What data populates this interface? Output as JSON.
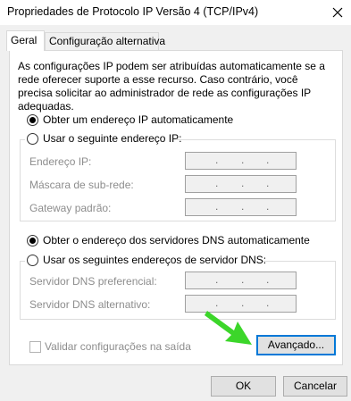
{
  "window": {
    "title": "Propriedades de Protocolo IP Versão 4 (TCP/IPv4)"
  },
  "tabs": [
    {
      "label": "Geral",
      "active": true
    },
    {
      "label": "Configuração alternativa",
      "active": false
    }
  ],
  "description": "As configurações IP podem ser atribuídas automaticamente se a rede oferecer suporte a esse recurso. Caso contrário, você precisa solicitar ao administrador de rede as configurações IP adequadas.",
  "ip": {
    "auto_label": "Obter um endereço IP automaticamente",
    "auto_selected": true,
    "manual_label": "Usar o seguinte endereço IP:",
    "fields": [
      {
        "label": "Endereço IP:",
        "value": ". . ."
      },
      {
        "label": "Máscara de sub-rede:",
        "value": ". . ."
      },
      {
        "label": "Gateway padrão:",
        "value": ". . ."
      }
    ]
  },
  "dns": {
    "auto_label": "Obter o endereço dos servidores DNS automaticamente",
    "auto_selected": true,
    "manual_label": "Usar os seguintes endereços de servidor DNS:",
    "fields": [
      {
        "label": "Servidor DNS preferencial:",
        "value": ". . ."
      },
      {
        "label": "Servidor DNS alternativo:",
        "value": ". . ."
      }
    ]
  },
  "validate": {
    "label": "Validar configurações na saída",
    "checked": false
  },
  "buttons": {
    "advanced": "Avançado...",
    "ok": "OK",
    "cancel": "Cancelar"
  },
  "colors": {
    "accent": "#0078d7",
    "arrow": "#3cd62a"
  },
  "icons": {
    "close": "close-icon",
    "annotation": "green-arrow-icon"
  }
}
